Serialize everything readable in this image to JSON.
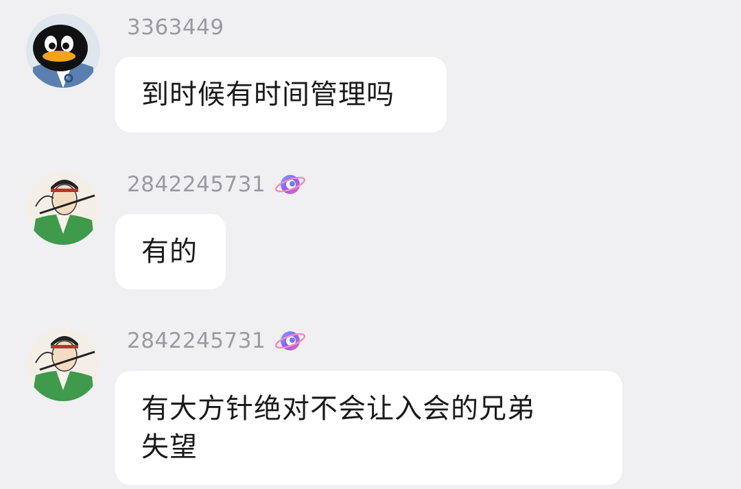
{
  "messages": [
    {
      "sender": "3363449",
      "avatar": "penguin-avatar",
      "text": "到时候有时间管理吗",
      "has_badge": false
    },
    {
      "sender": "2842245731",
      "avatar": "scholar-avatar",
      "text": "有的",
      "has_badge": true
    },
    {
      "sender": "2842245731",
      "avatar": "scholar-avatar",
      "text_line1": "有大方针绝对不会让入会的兄弟",
      "text_line2": "失望",
      "has_badge": true
    }
  ],
  "colors": {
    "background": "#f0f0f2",
    "bubble": "#ffffff",
    "sender_name": "#9a9aa2",
    "text": "#1a1a1a"
  }
}
